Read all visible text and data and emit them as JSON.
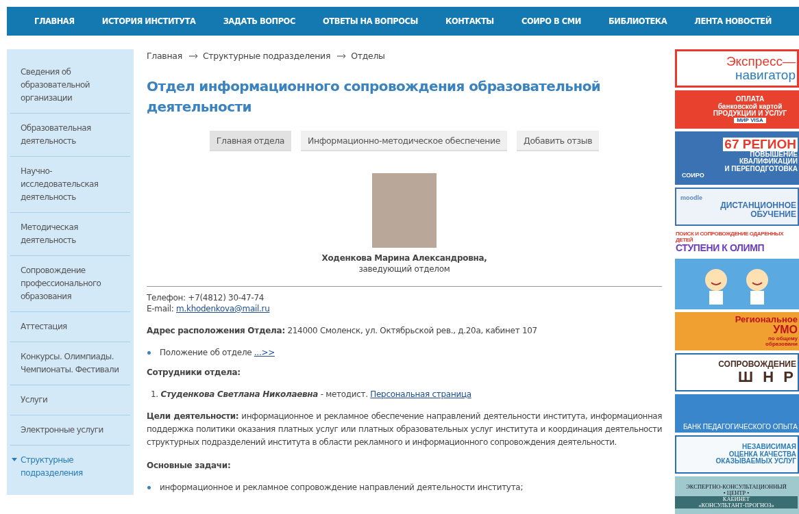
{
  "nav": [
    {
      "label": "ГЛАВНАЯ"
    },
    {
      "label": "ИСТОРИЯ ИНСТИТУТА"
    },
    {
      "label": "ЗАДАТЬ ВОПРОС"
    },
    {
      "label": "ОТВЕТЫ НА ВОПРОСЫ"
    },
    {
      "label": "КОНТАКТЫ"
    },
    {
      "label": "СОИРО В СМИ"
    },
    {
      "label": "БИБЛИОТЕКА"
    },
    {
      "label": "ЛЕНТА НОВОСТЕЙ"
    }
  ],
  "sidebar": {
    "items": [
      {
        "label": "Сведения об образовательной организации",
        "selected": false
      },
      {
        "label": "Образовательная деятельность",
        "selected": false
      },
      {
        "label": "Научно-исследовательская деятельность",
        "selected": false
      },
      {
        "label": "Методическая деятельность",
        "selected": false
      },
      {
        "label": "Сопровождение профессионального образования",
        "selected": false
      },
      {
        "label": "Аттестация",
        "selected": false
      },
      {
        "label": "Конкурсы. Олимпиады. Чемпионаты. Фестивали",
        "selected": false
      },
      {
        "label": "Услуги",
        "selected": false
      },
      {
        "label": "Электронные услуги",
        "selected": false
      },
      {
        "label": "Структурные подразделения",
        "selected": true
      }
    ]
  },
  "breadcrumbs": [
    "Главная",
    "Структурные подразделения",
    "Отделы"
  ],
  "title": "Отдел информационного сопровождения образовательной деятельности",
  "tabs": [
    {
      "label": "Главная отдела",
      "selected": true
    },
    {
      "label": "Информационно-методическое обеспечение",
      "selected": false
    },
    {
      "label": "Добавить отзыв",
      "selected": false
    }
  ],
  "head": {
    "name": "Ходенкова Марина Александровна,",
    "position": "заведующий отделом"
  },
  "phone": "Телефон: +7(4812) 30-47-74",
  "email": {
    "label": "E-mail:",
    "link": "m.khodenkova@mail.ru"
  },
  "address": "**Адрес расположения Отдела:** 214000 Смоленск, ул. Октябрьской рев., д.20а, кабинет 107",
  "regulation": {
    "text": "Положение об отделе",
    "link": "...>>"
  },
  "staff_heading": "Сотрудники отдела:",
  "staff": [
    {
      "number": "1.",
      "name": "Студенкова Светлана Николаевна",
      "role": "- методист.",
      "link": "Персональная страница"
    }
  ],
  "goals": "**Цели деятельности:** информационное и рекламное обеспечение направлений деятельности института, информационная поддержка политики оказания платных услуг или платных образовательных услуг института и координация деятельности структурных подразделений института в области рекламного и информационного сопровождения деятельности.",
  "tasks_heading": "Основные задачи:",
  "tasks": [
    "информационное и рекламное сопровождение направлений деятельности института;"
  ],
  "banners": [
    {
      "kind": "express",
      "lines": [
        "Экспресс—",
        "навигатор"
      ]
    },
    {
      "kind": "payment",
      "lines": [
        "ОПЛАТА",
        "банковской картой",
        "ПРОДУКЦИИ И УСЛУГ",
        "МИР   VISA"
      ]
    },
    {
      "kind": "region",
      "lines": [
        "67 РЕГИОН",
        "ПОВЫШЕНИЕ",
        "КВАЛИФИКАЦИИ",
        "И ПЕРЕПОДГОТОВКА",
        "СОИРО"
      ]
    },
    {
      "kind": "moodle",
      "lines": [
        "moodle",
        "ДИСТАНЦИОННОЕ",
        "ОБУЧЕНИЕ"
      ]
    },
    {
      "kind": "olymp",
      "lines": [
        "ПОИСК И СОПРОВОЖДЕНИЕ ОДАРЕННЫХ ДЕТЕЙ",
        "СТУПЕНИ К ОЛИМП"
      ]
    },
    {
      "kind": "kids"
    },
    {
      "kind": "umo",
      "lines": [
        "Региональное",
        "УМО",
        "по общему",
        "образовани"
      ]
    },
    {
      "kind": "shnro",
      "lines": [
        "СОПРОВОЖДЕНИЕ",
        "Ш Н Р"
      ]
    },
    {
      "kind": "bank",
      "lines": [
        "БАНК ПЕДАГОГИЧЕСКОГО ОПЫТА"
      ]
    },
    {
      "kind": "quality",
      "lines": [
        "НЕЗАВИСИМАЯ",
        "ОЦЕНКА КАЧЕСТВА",
        "ОКАЗЫВАЕМЫХ УСЛУГ"
      ]
    },
    {
      "kind": "expert",
      "lines": [
        "ЭКСПЕРТНО-КОНСУЛЬТАЦИОННЫЙ",
        "• ЦЕНТР •",
        "КАБИНЕТ",
        "«КОНСУЛЬТАНТ-ПРОГНОЗ»"
      ]
    }
  ]
}
